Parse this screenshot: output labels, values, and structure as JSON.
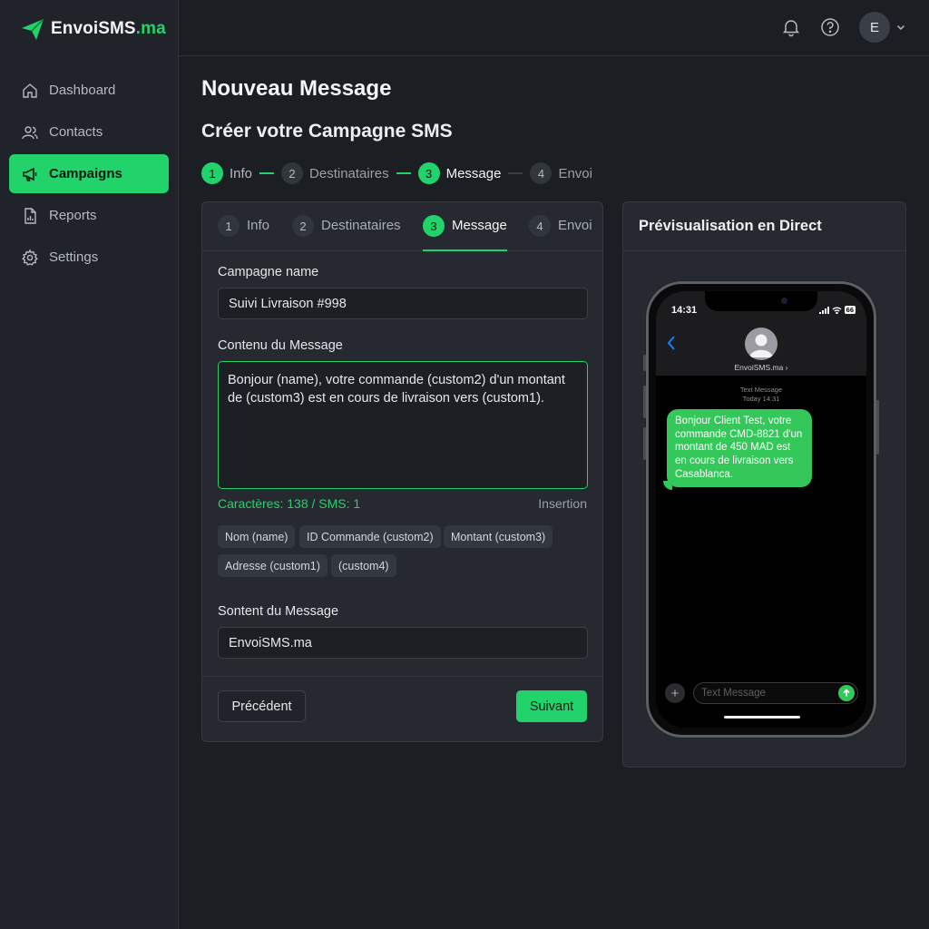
{
  "brand": {
    "name": "EnvoiSMS",
    "tld": ".ma",
    "accent": "#22d36b"
  },
  "sidebar": {
    "items": [
      {
        "label": "Dashboard",
        "icon": "home-icon",
        "active": false
      },
      {
        "label": "Contacts",
        "icon": "users-icon",
        "active": false
      },
      {
        "label": "Campaigns",
        "icon": "megaphone-icon",
        "active": true
      },
      {
        "label": "Reports",
        "icon": "report-icon",
        "active": false
      },
      {
        "label": "Settings",
        "icon": "gear-icon",
        "active": false
      }
    ]
  },
  "topbar": {
    "avatar_initial": "E",
    "icons": [
      "bell-icon",
      "help-icon",
      "chevron-down-icon"
    ]
  },
  "page": {
    "title": "Nouveau Message",
    "subtitle": "Créer votre Campagne SMS"
  },
  "stepper": [
    {
      "num": "1",
      "label": "Info",
      "state": "done"
    },
    {
      "num": "2",
      "label": "Destinataires",
      "state": "pending"
    },
    {
      "num": "3",
      "label": "Message",
      "state": "current"
    },
    {
      "num": "4",
      "label": "Envoi",
      "state": "pending"
    }
  ],
  "form": {
    "tabs": [
      {
        "num": "1",
        "label": "Info"
      },
      {
        "num": "2",
        "label": "Destinataires"
      },
      {
        "num": "3",
        "label": "Message"
      },
      {
        "num": "4",
        "label": "Envoi"
      }
    ],
    "campaign_label": "Campagne name",
    "campaign_value": "Suivi Livraison #998",
    "content_label": "Contenu du Message",
    "content_value": "Bonjour (name), votre commande (custom2) d'un montant de (custom3) est en cours de livraison vers (custom1).",
    "char_count": "Caractères: 138 / SMS: 1",
    "insertion_label": "Insertion",
    "chips": [
      "Nom (name)",
      "ID Commande (custom2)",
      "Montant (custom3)",
      "Adresse (custom1)",
      "(custom4)"
    ],
    "sender_label": "Sontent du Message",
    "sender_value": "EnvoiSMS.ma",
    "prev_label": "Précédent",
    "next_label": "Suivant"
  },
  "preview": {
    "title": "Prévisualisation en Direct",
    "status_time": "14:31",
    "battery": "66",
    "contact_name": "EnvoiSMS.ma ›",
    "meta_line1": "Text Message",
    "meta_line2": "Today 14:31",
    "bubble_text": "Bonjour Client Test, votre commande CMD-8821 d'un montant de 450 MAD est en cours de livraison vers Casablanca.",
    "compose_placeholder": "Text Message",
    "bubble_color": "#34c759"
  }
}
